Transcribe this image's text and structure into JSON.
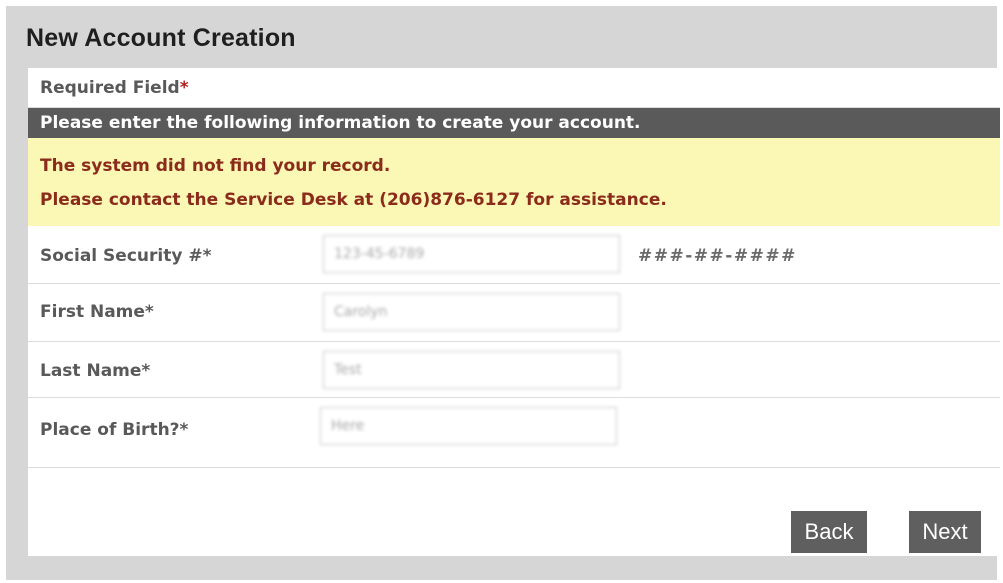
{
  "page": {
    "title": "New Account Creation"
  },
  "form": {
    "required_label": "Required Field",
    "required_star": "*",
    "info_banner": "Please enter the following information to create your account.",
    "alert": {
      "line1": "The system did not find your record.",
      "line2": "Please contact the Service Desk at (206)876-6127 for assistance."
    },
    "fields": [
      {
        "label": "Social Security #*",
        "value": "123-45-6789",
        "hint": "###-##-####"
      },
      {
        "label": "First Name*",
        "value": "Carolyn"
      },
      {
        "label": "Last Name*",
        "value": "Test"
      },
      {
        "label": "Place of Birth?*",
        "value": "Here"
      }
    ]
  },
  "buttons": {
    "back": "Back",
    "next": "Next"
  },
  "colors": {
    "frame_bg": "#d6d6d6",
    "info_bar_bg": "#5a5a5a",
    "alert_bg": "#fbf7b4",
    "alert_text": "#8b2b1c",
    "button_bg": "#5f5f5f"
  }
}
